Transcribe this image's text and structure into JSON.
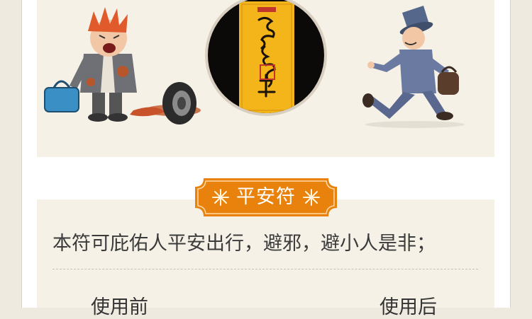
{
  "section_title": "平安符",
  "description": "本符可庇佑人平安出行，避邪，避小人是非；",
  "before_label": "使用前",
  "after_label": "使用后",
  "colors": {
    "badge": "#e8820c",
    "talisman": "#f3b51a",
    "ink": "#111111"
  }
}
